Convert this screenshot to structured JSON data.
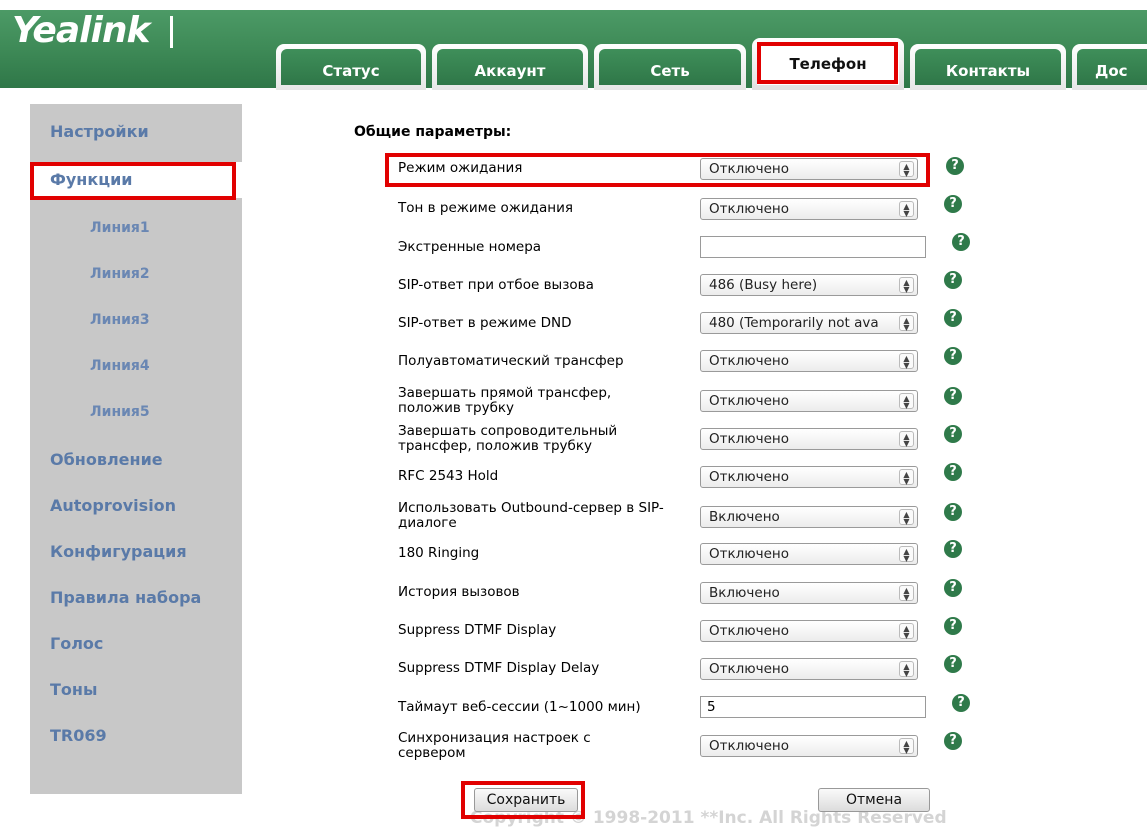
{
  "brand": {
    "logo": "Yealink",
    "colors": {
      "header_green": "#3e8a57",
      "highlight_red": "#e10000",
      "sidebar_gray": "#c8c8c8",
      "link_blue": "#5a7aa8"
    }
  },
  "tabs": [
    {
      "label": "Статус"
    },
    {
      "label": "Аккаунт"
    },
    {
      "label": "Сеть"
    },
    {
      "label": "Телефон",
      "active": true
    },
    {
      "label": "Контакты"
    },
    {
      "label": "Дос"
    }
  ],
  "sidebar": {
    "items": [
      {
        "label": "Настройки"
      },
      {
        "label": "Функции",
        "active": true
      },
      {
        "label": "Линия1"
      },
      {
        "label": "Линия2"
      },
      {
        "label": "Линия3"
      },
      {
        "label": "Линия4"
      },
      {
        "label": "Линия5"
      },
      {
        "label": "Обновление"
      },
      {
        "label": "Autoprovision"
      },
      {
        "label": "Конфигурация"
      },
      {
        "label": "Правила набора"
      },
      {
        "label": "Голос"
      },
      {
        "label": "Тоны"
      },
      {
        "label": "TR069"
      }
    ]
  },
  "section": {
    "title": "Общие параметры:"
  },
  "rows": [
    {
      "label": "Режим ожидания",
      "value": "Отключено"
    },
    {
      "label": "Тон в режиме ожидания",
      "value": "Отключено"
    },
    {
      "label": "Экстренные номера",
      "value": ""
    },
    {
      "label": "SIP-ответ при отбое вызова",
      "value": "486 (Busy here)"
    },
    {
      "label": "SIP-ответ в режиме DND",
      "value": "480 (Temporarily not ava"
    },
    {
      "label": "Полуавтоматический трансфер",
      "value": "Отключено"
    },
    {
      "label": "Завершать прямой трансфер, положив трубку",
      "value": "Отключено"
    },
    {
      "label": "Завершать сопроводительный трансфер, положив трубку",
      "value": "Отключено"
    },
    {
      "label": "RFC 2543 Hold",
      "value": "Отключено"
    },
    {
      "label": "Использовать Outbound-сервер в SIP-диалоге",
      "value": "Включено"
    },
    {
      "label": "180 Ringing",
      "value": "Отключено"
    },
    {
      "label": "История вызовов",
      "value": "Включено"
    },
    {
      "label": "Suppress DTMF Display",
      "value": "Отключено"
    },
    {
      "label": "Suppress DTMF Display Delay",
      "value": "Отключено"
    },
    {
      "label": "Таймаут веб-сессии (1~1000 мин)",
      "value": "5"
    },
    {
      "label": "Синхронизация настроек с сервером",
      "value": "Отключено"
    }
  ],
  "help_glyph": "?",
  "buttons": {
    "save": "Сохранить",
    "cancel": "Отмена"
  },
  "footer": {
    "copyright": "Copyright © 1998-2011 **Inc. All Rights Reserved"
  }
}
